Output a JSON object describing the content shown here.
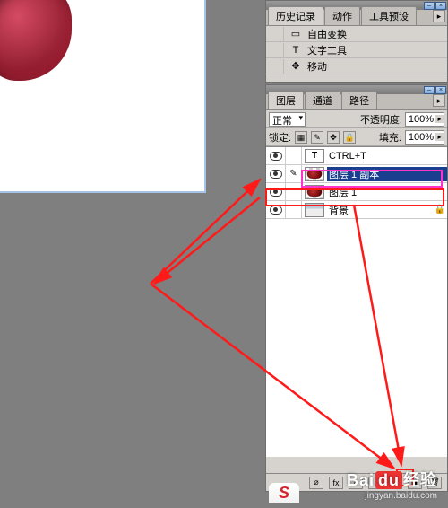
{
  "history_panel": {
    "tabs": [
      "历史记录",
      "动作",
      "工具预设"
    ],
    "items": [
      {
        "icon": "transform-icon",
        "glyph": "▭",
        "label": "自由变换"
      },
      {
        "icon": "type-icon",
        "glyph": "T",
        "label": "文字工具"
      },
      {
        "icon": "move-icon",
        "glyph": "✥",
        "label": "移动"
      }
    ]
  },
  "layers_panel": {
    "tabs": [
      "图层",
      "通道",
      "路径"
    ],
    "blend_label": "正常",
    "opacity_label": "不透明度:",
    "opacity_value": "100%",
    "lock_label": "锁定:",
    "fill_label": "填充:",
    "fill_value": "100%",
    "layers": [
      {
        "visible": true,
        "linked": false,
        "type": "text",
        "thumb_glyph": "T",
        "name": "CTRL+T",
        "selected": false,
        "locked": false
      },
      {
        "visible": true,
        "linked": true,
        "type": "image",
        "thumb_glyph": "",
        "name": "图层 1 副本",
        "selected": true,
        "locked": false
      },
      {
        "visible": true,
        "linked": false,
        "type": "image",
        "thumb_glyph": "",
        "name": "图层 1",
        "selected": false,
        "locked": false
      },
      {
        "visible": true,
        "linked": false,
        "type": "bg",
        "thumb_glyph": "",
        "name": "背景",
        "selected": false,
        "locked": true
      }
    ],
    "bottom_icons": [
      "fx-icon",
      "mask-icon",
      "folder-icon",
      "adjust-icon",
      "new-layer-icon",
      "trash-icon"
    ]
  },
  "watermark": {
    "brand_pre": "Bai",
    "brand_hi": "du",
    "brand_post": "经验",
    "url": "jingyan.baidu.com",
    "logo": "S"
  },
  "colors": {
    "pink": "#ff33cc",
    "red": "#ff1a1a",
    "arrow": "#ff1a1a"
  }
}
